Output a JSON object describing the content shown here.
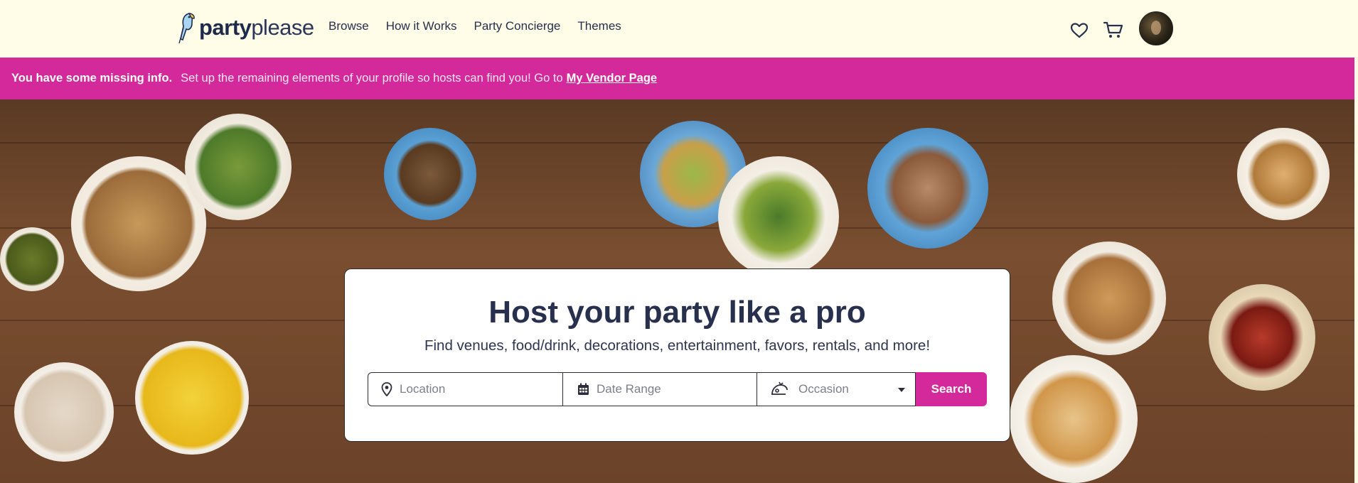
{
  "brand": {
    "name_bold": "party",
    "name_light": "please"
  },
  "nav": {
    "items": [
      {
        "label": "Browse"
      },
      {
        "label": "How it Works"
      },
      {
        "label": "Party Concierge"
      },
      {
        "label": "Themes"
      }
    ]
  },
  "header_icons": [
    "heart-icon",
    "cart-icon",
    "avatar"
  ],
  "banner": {
    "bold": "You have some missing info.",
    "message": "Set up the remaining elements of your profile so hosts can find you! Go to",
    "link": "My Vendor Page"
  },
  "hero": {
    "title": "Host your party like a pro",
    "subtitle": "Find venues, food/drink, decorations, entertainment, favors, rentals, and more!",
    "search": {
      "location_placeholder": "Location",
      "date_placeholder": "Date Range",
      "occasion_placeholder": "Occasion",
      "button": "Search"
    }
  },
  "colors": {
    "accent": "#d4299b",
    "header_bg": "#fffce8",
    "text_dark": "#27304d"
  }
}
